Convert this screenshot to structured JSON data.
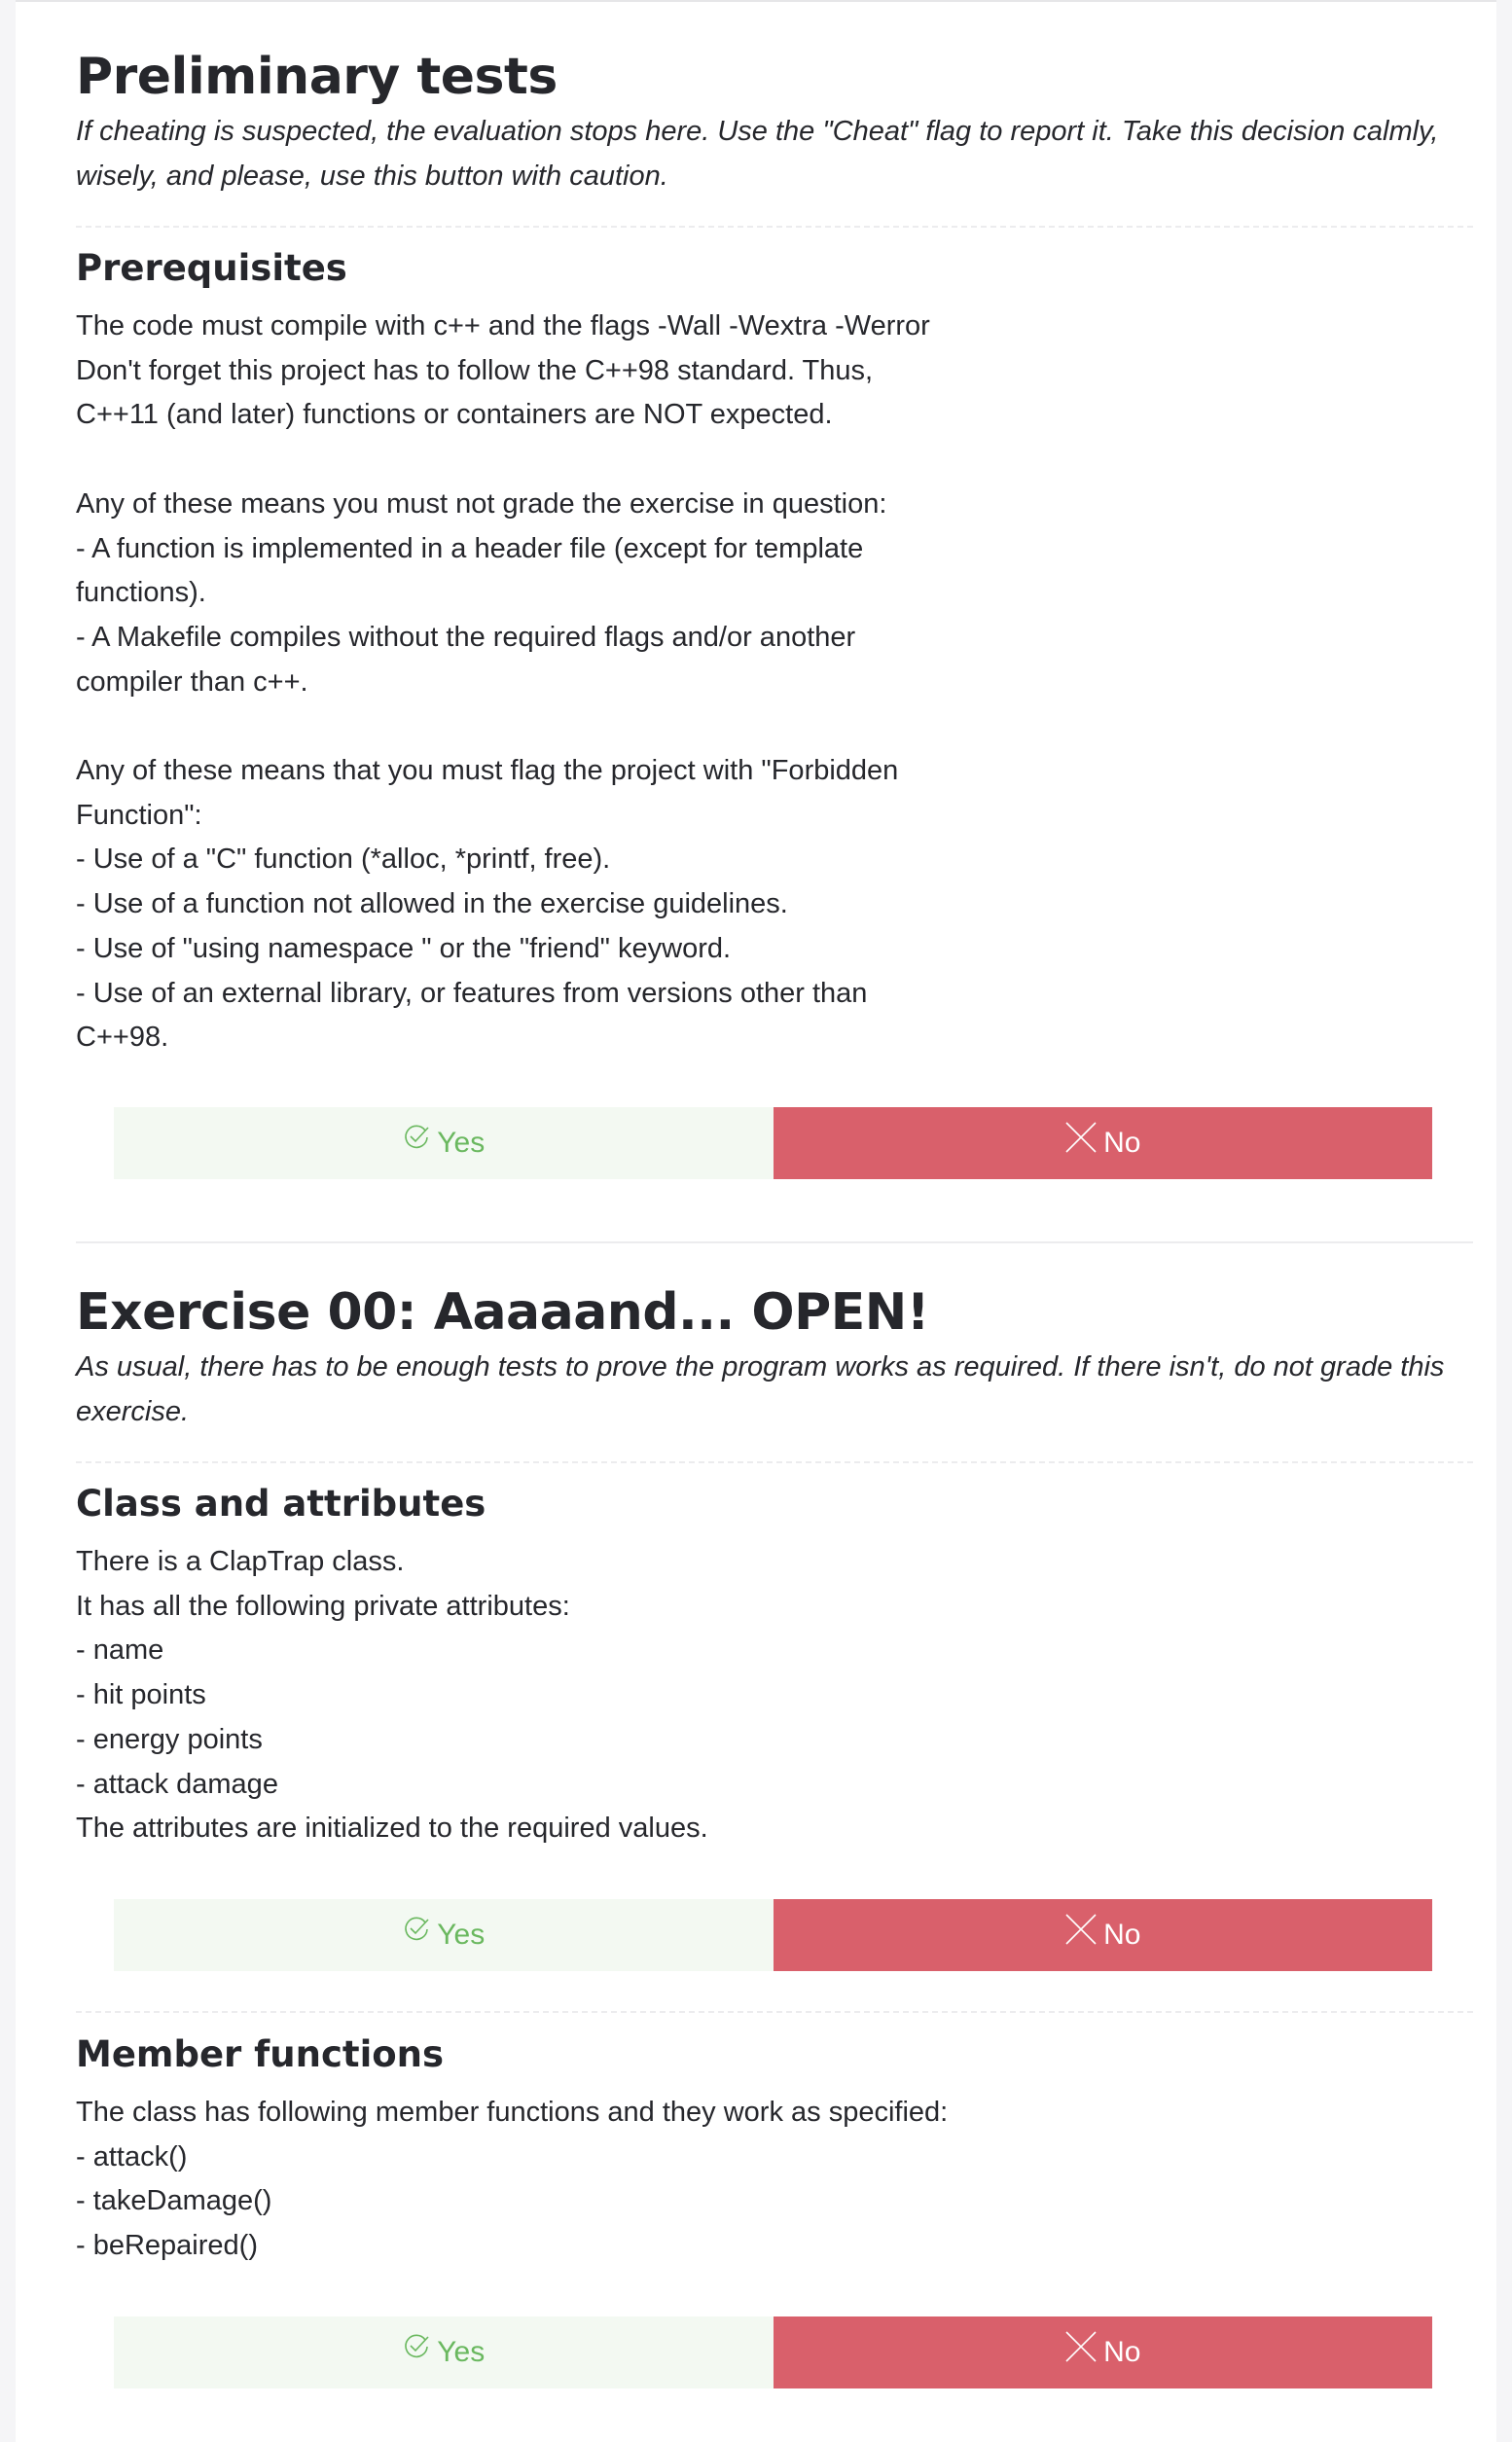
{
  "section1": {
    "title": "Preliminary tests",
    "description": "If cheating is suspected, the evaluation stops here. Use the \"Cheat\" flag to report it. Take this decision calmly, wisely, and please, use this button with caution.",
    "subsection": {
      "title": "Prerequisites",
      "body": "The code must compile with c++ and the flags -Wall -Wextra -Werror\nDon't forget this project has to follow the C++98 standard. Thus,\nC++11 (and later) functions or containers are NOT expected.\n\nAny of these means you must not grade the exercise in question:\n- A function is implemented in a header file (except for template\nfunctions).\n- A Makefile compiles without the required flags and/or another\ncompiler than c++.\n\nAny of these means that you must flag the project with \"Forbidden\nFunction\":\n- Use of a \"C\" function (*alloc, *printf, free).\n- Use of a function not allowed in the exercise guidelines.\n- Use of \"using namespace \" or the \"friend\" keyword.\n- Use of an external library, or features from versions other than\nC++98.",
      "yes_label": "Yes",
      "no_label": "No"
    }
  },
  "section2": {
    "title": "Exercise 00: Aaaaand... OPEN!",
    "description": "As usual, there has to be enough tests to prove the program works as required. If there isn't, do not grade this exercise.",
    "subsections": [
      {
        "title": "Class and attributes",
        "body": "There is a ClapTrap class.\nIt has all the following private attributes:\n- name\n- hit points\n- energy points\n- attack damage\nThe attributes are initialized to the required values.",
        "yes_label": "Yes",
        "no_label": "No"
      },
      {
        "title": "Member functions",
        "body": "The class has following member functions and they work as specified:\n- attack()\n- takeDamage()\n- beRepaired()",
        "yes_label": "Yes",
        "no_label": "No"
      }
    ]
  },
  "icons": {
    "yes": "check-circle-icon",
    "no": "x-close-icon"
  },
  "colors": {
    "yes_bg": "#f3f9f2",
    "yes_fg": "#6ab85f",
    "no_bg": "#d9606b",
    "no_fg": "#ffffff"
  }
}
